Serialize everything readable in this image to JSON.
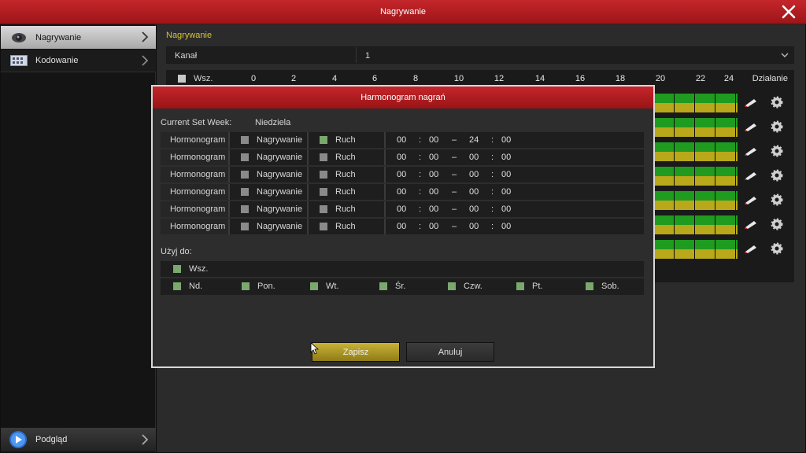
{
  "window": {
    "title": "Nagrywanie"
  },
  "sidebar": {
    "items": [
      {
        "label": "Nagrywanie",
        "icon": "camera-icon"
      },
      {
        "label": "Kodowanie",
        "icon": "film-icon"
      }
    ],
    "bottom": {
      "label": "Podgląd",
      "icon": "play-icon"
    }
  },
  "main": {
    "section_title": "Nagrywanie",
    "channel_label": "Kanał",
    "channel_value": "1",
    "schedule_all_label": "Wsz.",
    "hours": [
      "0",
      "2",
      "4",
      "6",
      "8",
      "10",
      "12",
      "14",
      "16",
      "18",
      "20",
      "22",
      "24"
    ],
    "action_label": "Działanie"
  },
  "dialog": {
    "title": "Harmonogram nagrań",
    "week_label": "Current Set Week:",
    "week_value": "Niedziela",
    "rows": [
      {
        "name": "Hormonogram",
        "rec_label": "Nagrywanie",
        "motion_label": "Ruch",
        "rec_checked": false,
        "motion_checked": true,
        "start_h": "00",
        "start_m": "00",
        "end_h": "24",
        "end_m": "00"
      },
      {
        "name": "Hormonogram",
        "rec_label": "Nagrywanie",
        "motion_label": "Ruch",
        "rec_checked": false,
        "motion_checked": false,
        "start_h": "00",
        "start_m": "00",
        "end_h": "00",
        "end_m": "00"
      },
      {
        "name": "Hormonogram",
        "rec_label": "Nagrywanie",
        "motion_label": "Ruch",
        "rec_checked": false,
        "motion_checked": false,
        "start_h": "00",
        "start_m": "00",
        "end_h": "00",
        "end_m": "00"
      },
      {
        "name": "Hormonogram",
        "rec_label": "Nagrywanie",
        "motion_label": "Ruch",
        "rec_checked": false,
        "motion_checked": false,
        "start_h": "00",
        "start_m": "00",
        "end_h": "00",
        "end_m": "00"
      },
      {
        "name": "Hormonogram",
        "rec_label": "Nagrywanie",
        "motion_label": "Ruch",
        "rec_checked": false,
        "motion_checked": false,
        "start_h": "00",
        "start_m": "00",
        "end_h": "00",
        "end_m": "00"
      },
      {
        "name": "Hormonogram",
        "rec_label": "Nagrywanie",
        "motion_label": "Ruch",
        "rec_checked": false,
        "motion_checked": false,
        "start_h": "00",
        "start_m": "00",
        "end_h": "00",
        "end_m": "00"
      }
    ],
    "time_sep": ":",
    "range_sep": "–",
    "use_label": "Użyj do:",
    "all_label": "Wsz.",
    "days": [
      "Nd.",
      "Pon.",
      "Wt.",
      "Śr.",
      "Czw.",
      "Pt.",
      "Sob."
    ],
    "save_label": "Zapisz",
    "cancel_label": "Anuluj"
  },
  "colors": {
    "accent_red": "#b01c1f",
    "record_green": "#1f9b1f",
    "motion_yellow": "#b9a81a",
    "save_gold": "#b39f28"
  }
}
